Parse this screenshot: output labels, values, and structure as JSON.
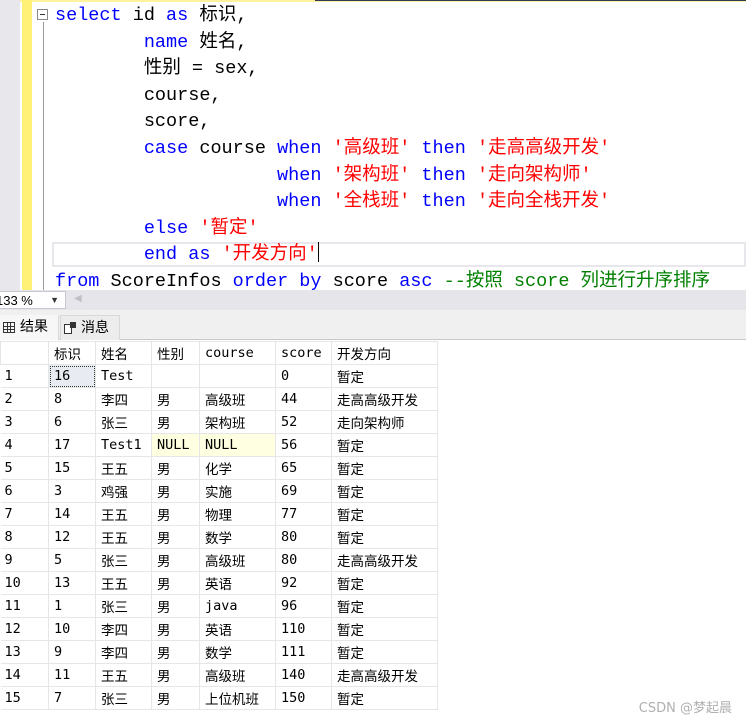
{
  "editor": {
    "lines": [
      [
        {
          "t": "kw",
          "v": "select"
        },
        {
          "t": "plain",
          "v": " id "
        },
        {
          "t": "kw",
          "v": "as"
        },
        {
          "t": "plain",
          "v": " 标识,"
        }
      ],
      [
        {
          "t": "plain",
          "v": "        "
        },
        {
          "t": "kw",
          "v": "name"
        },
        {
          "t": "plain",
          "v": " 姓名,"
        }
      ],
      [
        {
          "t": "plain",
          "v": "        性别 = sex,"
        }
      ],
      [
        {
          "t": "plain",
          "v": "        course,"
        }
      ],
      [
        {
          "t": "plain",
          "v": "        score,"
        }
      ],
      [
        {
          "t": "plain",
          "v": "        "
        },
        {
          "t": "kw",
          "v": "case"
        },
        {
          "t": "plain",
          "v": " course "
        },
        {
          "t": "kw",
          "v": "when"
        },
        {
          "t": "plain",
          "v": " "
        },
        {
          "t": "str",
          "v": "'高级班'"
        },
        {
          "t": "plain",
          "v": " "
        },
        {
          "t": "kw",
          "v": "then"
        },
        {
          "t": "plain",
          "v": " "
        },
        {
          "t": "str",
          "v": "'走高高级开发'"
        }
      ],
      [
        {
          "t": "plain",
          "v": "                    "
        },
        {
          "t": "kw",
          "v": "when"
        },
        {
          "t": "plain",
          "v": " "
        },
        {
          "t": "str",
          "v": "'架构班'"
        },
        {
          "t": "plain",
          "v": " "
        },
        {
          "t": "kw",
          "v": "then"
        },
        {
          "t": "plain",
          "v": " "
        },
        {
          "t": "str",
          "v": "'走向架构师'"
        }
      ],
      [
        {
          "t": "plain",
          "v": "                    "
        },
        {
          "t": "kw",
          "v": "when"
        },
        {
          "t": "plain",
          "v": " "
        },
        {
          "t": "str",
          "v": "'全栈班'"
        },
        {
          "t": "plain",
          "v": " "
        },
        {
          "t": "kw",
          "v": "then"
        },
        {
          "t": "plain",
          "v": " "
        },
        {
          "t": "str",
          "v": "'走向全栈开发'"
        }
      ],
      [
        {
          "t": "plain",
          "v": "        "
        },
        {
          "t": "kw",
          "v": "else"
        },
        {
          "t": "plain",
          "v": " "
        },
        {
          "t": "str",
          "v": "'暂定'"
        }
      ],
      [
        {
          "t": "plain",
          "v": "        "
        },
        {
          "t": "kw",
          "v": "end"
        },
        {
          "t": "plain",
          "v": " "
        },
        {
          "t": "kw",
          "v": "as"
        },
        {
          "t": "plain",
          "v": " "
        },
        {
          "t": "str",
          "v": "'开发方向'"
        },
        {
          "t": "caret",
          "v": ""
        }
      ],
      [
        {
          "t": "kw",
          "v": "from"
        },
        {
          "t": "plain",
          "v": " ScoreInfos "
        },
        {
          "t": "kw",
          "v": "order by"
        },
        {
          "t": "plain",
          "v": " score "
        },
        {
          "t": "kw",
          "v": "asc"
        },
        {
          "t": "plain",
          "v": " "
        },
        {
          "t": "cmt",
          "v": "--按照 score 列进行升序排序"
        }
      ]
    ]
  },
  "zoom": {
    "value": "133 %",
    "dropdown_icon": "chevron-down-icon",
    "scroll_left_icon": "scroll-left-icon"
  },
  "tabs": {
    "results": {
      "label": "结果",
      "icon": "grid-icon"
    },
    "messages": {
      "label": "消息",
      "icon": "messages-icon"
    }
  },
  "grid": {
    "columns": [
      "",
      "标识",
      "姓名",
      "性别",
      "course",
      "score",
      "开发方向"
    ],
    "rows": [
      [
        "1",
        "16",
        "Test",
        "",
        "",
        "0",
        "暂定"
      ],
      [
        "2",
        "8",
        "李四",
        "男",
        "高级班",
        "44",
        "走高高级开发"
      ],
      [
        "3",
        "6",
        "张三",
        "男",
        "架构班",
        "52",
        "走向架构师"
      ],
      [
        "4",
        "17",
        "Test1",
        "NULL",
        "NULL",
        "56",
        "暂定"
      ],
      [
        "5",
        "15",
        "王五",
        "男",
        "化学",
        "65",
        "暂定"
      ],
      [
        "6",
        "3",
        "鸡强",
        "男",
        "实施",
        "69",
        "暂定"
      ],
      [
        "7",
        "14",
        "王五",
        "男",
        "物理",
        "77",
        "暂定"
      ],
      [
        "8",
        "12",
        "王五",
        "男",
        "数学",
        "80",
        "暂定"
      ],
      [
        "9",
        "5",
        "张三",
        "男",
        "高级班",
        "80",
        "走高高级开发"
      ],
      [
        "10",
        "13",
        "王五",
        "男",
        "英语",
        "92",
        "暂定"
      ],
      [
        "11",
        "1",
        "张三",
        "男",
        "java",
        "96",
        "暂定"
      ],
      [
        "12",
        "10",
        "李四",
        "男",
        "英语",
        "110",
        "暂定"
      ],
      [
        "13",
        "9",
        "李四",
        "男",
        "数学",
        "111",
        "暂定"
      ],
      [
        "14",
        "11",
        "王五",
        "男",
        "高级班",
        "140",
        "走高高级开发"
      ],
      [
        "15",
        "7",
        "张三",
        "男",
        "上位机班",
        "150",
        "暂定"
      ]
    ],
    "selected_cell": {
      "row": 0,
      "col": 1
    },
    "null_value": "NULL"
  },
  "watermark": "CSDN @梦起晨",
  "colors": {
    "keyword": "#0000ff",
    "string": "#ff0000",
    "comment": "#008000",
    "null_cell_bg": "#ffffe1",
    "change_bar": "#fff176"
  }
}
